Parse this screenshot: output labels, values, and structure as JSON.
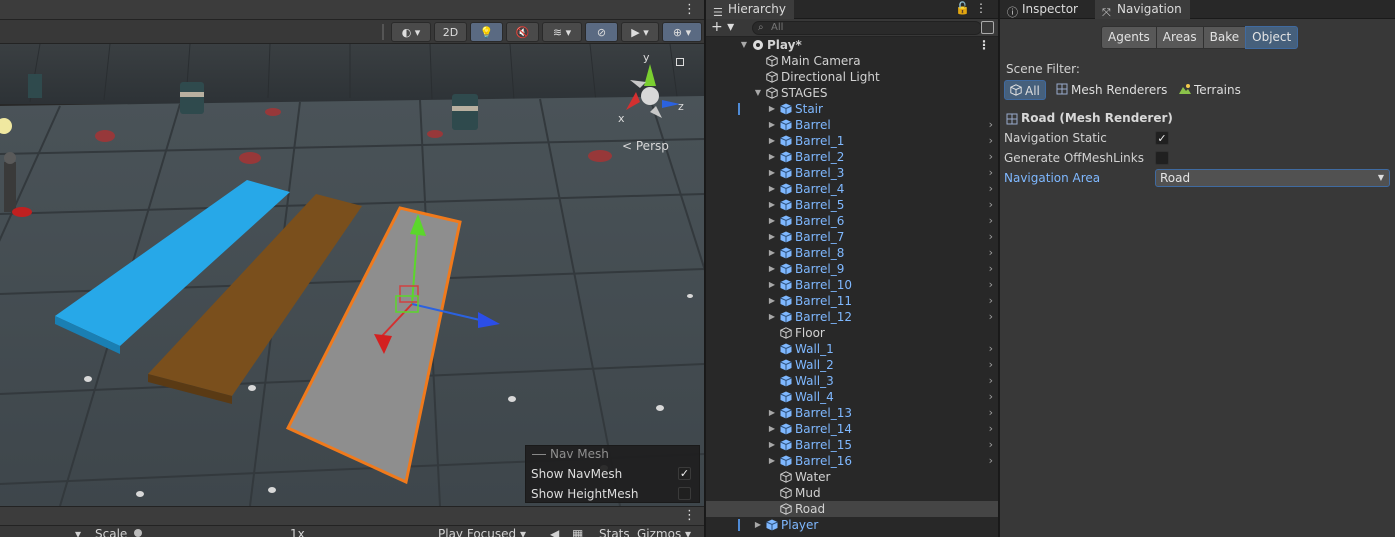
{
  "scene": {
    "toolbar": {
      "mode_2d": "2D",
      "persp_label": "Persp"
    },
    "gizmo_axes": [
      "y",
      "x",
      "z"
    ],
    "navmesh_panel": {
      "title": "Nav Mesh",
      "show_navmesh": "Show NavMesh",
      "show_navmesh_checked": true,
      "show_heightmesh": "Show HeightMesh",
      "show_heightmesh_checked": false
    },
    "game_bar": {
      "scale_label": "Scale",
      "scale_value": "1x",
      "play_mode": "Play Focused",
      "stats": "Stats",
      "gizmos": "Gizmos"
    }
  },
  "hierarchy": {
    "tab_label": "Hierarchy",
    "search_placeholder": "All",
    "items": [
      {
        "label": "Play*",
        "depth": 0,
        "arrow": "down",
        "type": "scene",
        "bold": true
      },
      {
        "label": "Main Camera",
        "depth": 1,
        "arrow": "",
        "type": "object"
      },
      {
        "label": "Directional Light",
        "depth": 1,
        "arrow": "",
        "type": "object"
      },
      {
        "label": "STAGES",
        "depth": 1,
        "arrow": "down",
        "type": "object"
      },
      {
        "label": "Stair",
        "depth": 2,
        "arrow": "right",
        "type": "prefab",
        "mark": true
      },
      {
        "label": "Barrel",
        "depth": 2,
        "arrow": "right",
        "type": "prefab",
        "chev": true
      },
      {
        "label": "Barrel_1",
        "depth": 2,
        "arrow": "right",
        "type": "prefab",
        "chev": true
      },
      {
        "label": "Barrel_2",
        "depth": 2,
        "arrow": "right",
        "type": "prefab",
        "chev": true
      },
      {
        "label": "Barrel_3",
        "depth": 2,
        "arrow": "right",
        "type": "prefab",
        "chev": true
      },
      {
        "label": "Barrel_4",
        "depth": 2,
        "arrow": "right",
        "type": "prefab",
        "chev": true
      },
      {
        "label": "Barrel_5",
        "depth": 2,
        "arrow": "right",
        "type": "prefab",
        "chev": true
      },
      {
        "label": "Barrel_6",
        "depth": 2,
        "arrow": "right",
        "type": "prefab",
        "chev": true
      },
      {
        "label": "Barrel_7",
        "depth": 2,
        "arrow": "right",
        "type": "prefab",
        "chev": true
      },
      {
        "label": "Barrel_8",
        "depth": 2,
        "arrow": "right",
        "type": "prefab",
        "chev": true
      },
      {
        "label": "Barrel_9",
        "depth": 2,
        "arrow": "right",
        "type": "prefab",
        "chev": true
      },
      {
        "label": "Barrel_10",
        "depth": 2,
        "arrow": "right",
        "type": "prefab",
        "chev": true
      },
      {
        "label": "Barrel_11",
        "depth": 2,
        "arrow": "right",
        "type": "prefab",
        "chev": true
      },
      {
        "label": "Barrel_12",
        "depth": 2,
        "arrow": "right",
        "type": "prefab",
        "chev": true
      },
      {
        "label": "Floor",
        "depth": 2,
        "arrow": "",
        "type": "object"
      },
      {
        "label": "Wall_1",
        "depth": 2,
        "arrow": "",
        "type": "prefab",
        "chev": true
      },
      {
        "label": "Wall_2",
        "depth": 2,
        "arrow": "",
        "type": "prefab",
        "chev": true
      },
      {
        "label": "Wall_3",
        "depth": 2,
        "arrow": "",
        "type": "prefab",
        "chev": true
      },
      {
        "label": "Wall_4",
        "depth": 2,
        "arrow": "",
        "type": "prefab",
        "chev": true
      },
      {
        "label": "Barrel_13",
        "depth": 2,
        "arrow": "right",
        "type": "prefab",
        "chev": true
      },
      {
        "label": "Barrel_14",
        "depth": 2,
        "arrow": "right",
        "type": "prefab",
        "chev": true
      },
      {
        "label": "Barrel_15",
        "depth": 2,
        "arrow": "right",
        "type": "prefab",
        "chev": true
      },
      {
        "label": "Barrel_16",
        "depth": 2,
        "arrow": "right",
        "type": "prefab",
        "chev": true
      },
      {
        "label": "Water",
        "depth": 2,
        "arrow": "",
        "type": "object"
      },
      {
        "label": "Mud",
        "depth": 2,
        "arrow": "",
        "type": "object"
      },
      {
        "label": "Road",
        "depth": 2,
        "arrow": "",
        "type": "object",
        "selected": true
      },
      {
        "label": "Player",
        "depth": 1,
        "arrow": "right",
        "type": "prefab",
        "mark": true
      }
    ]
  },
  "inspector": {
    "tab_inspector": "Inspector",
    "tab_navigation": "Navigation",
    "nav_tabs": [
      {
        "label": "Agents",
        "active": false
      },
      {
        "label": "Areas",
        "active": false
      },
      {
        "label": "Bake",
        "active": false
      },
      {
        "label": "Object",
        "active": true
      }
    ],
    "scene_filter_label": "Scene Filter:",
    "filters": [
      {
        "label": "All",
        "active": true,
        "icon": "cube-icon"
      },
      {
        "label": "Mesh Renderers",
        "active": false,
        "icon": "grid-icon"
      },
      {
        "label": "Terrains",
        "active": false,
        "icon": "terrain-icon"
      }
    ],
    "object_title": "Road (Mesh Renderer)",
    "navigation_static_label": "Navigation Static",
    "navigation_static": true,
    "offmesh_label": "Generate OffMeshLinks",
    "offmesh": false,
    "area_label": "Navigation Area",
    "area_value": "Road"
  },
  "colors": {
    "selection_blue": "#46607c",
    "prefab_text": "#7fb8ff",
    "road_outline": "#f07a1c",
    "platform_blue": "#27a8e8",
    "platform_brown": "#7a4f1c"
  }
}
